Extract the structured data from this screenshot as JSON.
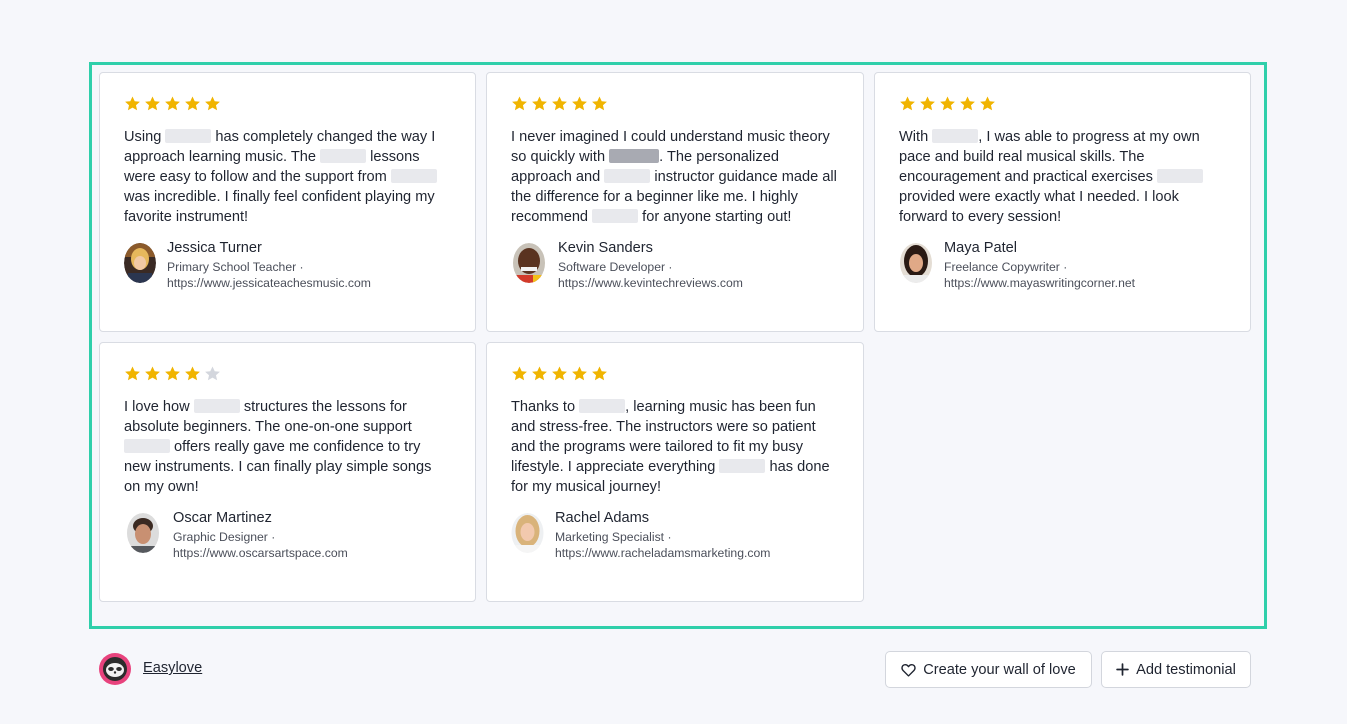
{
  "colors": {
    "accent_border": "#2fcfaa",
    "star": "#f0b400",
    "star_empty": "#d3d6dd",
    "brand": "#e8437d"
  },
  "testimonials": [
    {
      "rating": 5,
      "quote_parts": [
        "Using ",
        " has completely changed the way I approach learning music. The ",
        " lessons were easy to follow and the support from ",
        " was incredible. I finally feel confident playing my favorite instrument!"
      ],
      "name": "Jessica Turner",
      "role": "Primary School Teacher ·",
      "url": "https://www.jessicateachesmusic.com",
      "avatar_icon": "avatar-photo"
    },
    {
      "rating": 5,
      "quote_parts": [
        "I never imagined I could understand music theory so quickly with ",
        ". The personalized approach and ",
        " instructor guidance made all the difference for a beginner like me. I highly recommend ",
        " for anyone starting out!"
      ],
      "name": "Kevin Sanders",
      "role": "Software Developer ·",
      "url": "https://www.kevintechreviews.com",
      "avatar_icon": "avatar-photo"
    },
    {
      "rating": 5,
      "quote_parts": [
        "With ",
        ", I was able to progress at my own pace and build real musical skills. The encouragement and practical exercises ",
        " provided were exactly what I needed. I look forward to every session!"
      ],
      "name": "Maya Patel",
      "role": "Freelance Copywriter ·",
      "url": "https://www.mayaswritingcorner.net",
      "avatar_icon": "avatar-photo"
    },
    {
      "rating": 4,
      "quote_parts": [
        "I love how ",
        " structures the lessons for absolute beginners. The one-on-one support ",
        " offers really gave me confidence to try new instruments. I can finally play simple songs on my own!"
      ],
      "name": "Oscar Martinez",
      "role": "Graphic Designer ·",
      "url": "https://www.oscarsartspace.com",
      "avatar_icon": "avatar-photo"
    },
    {
      "rating": 5,
      "quote_parts": [
        "Thanks to ",
        ", learning music has been fun and stress-free. The instructors were so patient and the programs were tailored to fit my busy lifestyle. I appreciate everything ",
        " has done for my musical journey!"
      ],
      "name": "Rachel Adams",
      "role": "Marketing Specialist ·",
      "url": "https://www.racheladamsmarketing.com",
      "avatar_icon": "avatar-photo"
    }
  ],
  "footer": {
    "brand": "Easylove",
    "logo_icon": "sloth-logo-icon",
    "create_button": {
      "label": "Create your wall of love",
      "icon": "heart-icon"
    },
    "add_button": {
      "label": "Add testimonial",
      "icon": "plus-icon"
    }
  }
}
